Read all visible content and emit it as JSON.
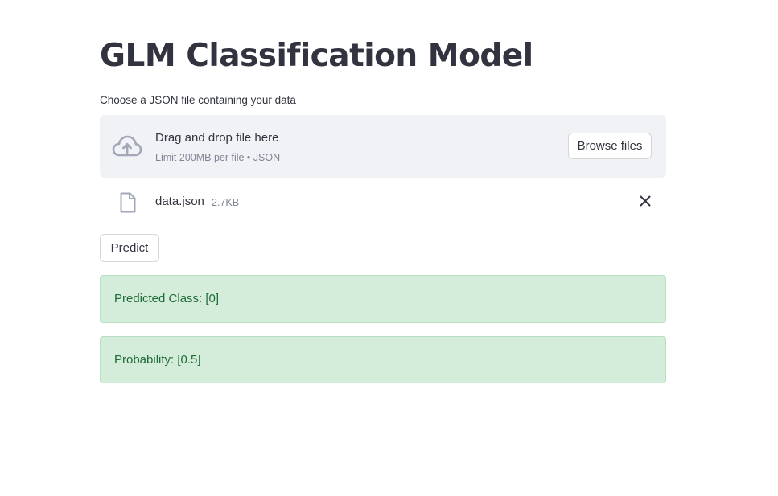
{
  "header": {
    "title": "GLM Classification Model"
  },
  "uploader": {
    "label": "Choose a JSON file containing your data",
    "drop_title": "Drag and drop file here",
    "drop_limit": "Limit 200MB per file • JSON",
    "browse_label": "Browse files",
    "icon": "cloud-upload-icon"
  },
  "uploaded_file": {
    "name": "data.json",
    "size": "2.7KB",
    "icon": "file-icon",
    "remove_icon": "close-icon"
  },
  "actions": {
    "predict_label": "Predict"
  },
  "results": {
    "predicted_class": "Predicted Class: [0]",
    "probability": "Probability: [0.5]"
  },
  "colors": {
    "text": "#31333f",
    "muted": "#808495",
    "dropzone_bg": "#f0f2f6",
    "success_bg": "#d4edda",
    "success_text": "#1e6a36",
    "icon": "#a3a8b8"
  }
}
